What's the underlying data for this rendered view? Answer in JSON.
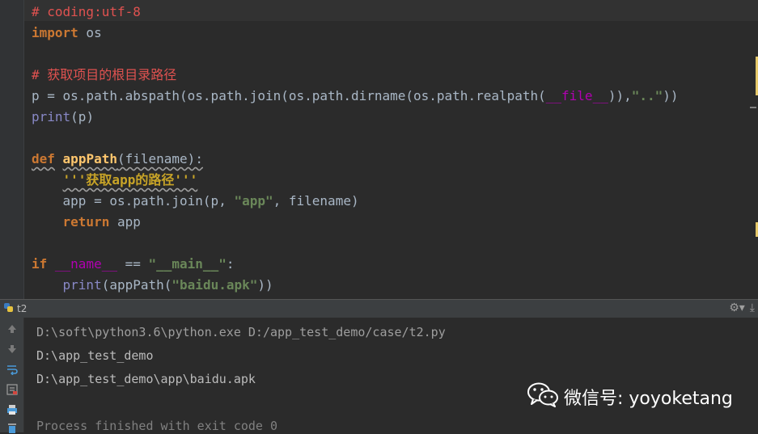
{
  "editor": {
    "lines": [
      [
        {
          "t": "# coding:utf-8",
          "c": "cmt"
        }
      ],
      [
        {
          "t": "import",
          "c": "kw"
        },
        {
          "t": " os",
          "c": ""
        }
      ],
      [],
      [
        {
          "t": "# 获取项目的根目录路径",
          "c": "cmt"
        }
      ],
      [
        {
          "t": "p = os.path.abspath(os.path.join(os.path.dirname(os.path.realpath(",
          "c": ""
        },
        {
          "t": "__file__",
          "c": "dunder"
        },
        {
          "t": ")),",
          "c": ""
        },
        {
          "t": "\"..\"",
          "c": "str"
        },
        {
          "t": "))",
          "c": ""
        }
      ],
      [
        {
          "t": "print",
          "c": "bi"
        },
        {
          "t": "(p)",
          "c": ""
        }
      ],
      [],
      [
        {
          "t": "def",
          "c": "kw wavy"
        },
        {
          "t": " ",
          "c": ""
        },
        {
          "t": "appPath",
          "c": "fn wavy"
        },
        {
          "t": "(filename):",
          "c": "wavy"
        }
      ],
      [
        {
          "t": "    ",
          "c": ""
        },
        {
          "t": "'''获取app的路径'''",
          "c": "doc wavy"
        }
      ],
      [
        {
          "t": "    app = os.path.join(p, ",
          "c": ""
        },
        {
          "t": "\"app\"",
          "c": "str"
        },
        {
          "t": ", filename)",
          "c": ""
        }
      ],
      [
        {
          "t": "    ",
          "c": ""
        },
        {
          "t": "return",
          "c": "kw"
        },
        {
          "t": " app",
          "c": ""
        }
      ],
      [],
      [
        {
          "t": "if",
          "c": "kw"
        },
        {
          "t": " ",
          "c": ""
        },
        {
          "t": "__name__",
          "c": "dunder"
        },
        {
          "t": " == ",
          "c": ""
        },
        {
          "t": "\"__main__\"",
          "c": "str"
        },
        {
          "t": ":",
          "c": ""
        }
      ],
      [
        {
          "t": "    ",
          "c": ""
        },
        {
          "t": "print",
          "c": "bi"
        },
        {
          "t": "(appPath(",
          "c": ""
        },
        {
          "t": "\"baidu.apk\"",
          "c": "str"
        },
        {
          "t": "))",
          "c": ""
        }
      ]
    ]
  },
  "run_panel": {
    "tab_name": "t2",
    "console": {
      "command": "D:\\soft\\python3.6\\python.exe D:/app_test_demo/case/t2.py",
      "output_1": "D:\\app_test_demo",
      "output_2": "D:\\app_test_demo\\app\\baidu.apk",
      "finish": "Process finished with exit code 0"
    }
  },
  "watermark": {
    "text": "微信号: yoyoketang"
  },
  "colors": {
    "background": "#2b2b2b",
    "keyword": "#cc7832",
    "comment": "#e05250",
    "string": "#6a8759",
    "docstring": "#c8a427",
    "builtin": "#8888c6",
    "function": "#ffc66d"
  }
}
